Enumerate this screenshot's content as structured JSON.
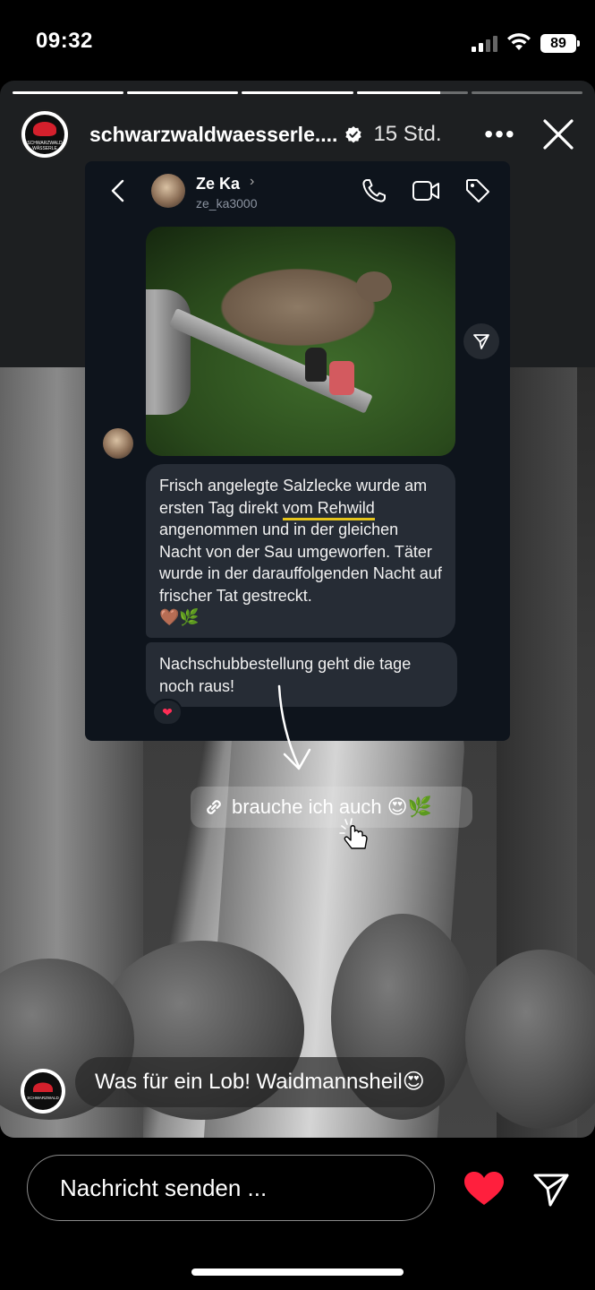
{
  "status_bar": {
    "time": "09:32",
    "battery": "89"
  },
  "story": {
    "username": "schwarzwaldwaesserle....",
    "time_ago": "15 Std.",
    "more": "•••",
    "progress": [
      1,
      1,
      1,
      0.75,
      0
    ]
  },
  "dm": {
    "contact_name": "Ze Ka",
    "contact_handle": "ze_ka3000",
    "message1_before": "Frisch angelegte Salzlecke  wurde am ersten Tag direkt ",
    "message1_highlight": "vom Rehwild",
    "message1_after": " angenommen  und in der gleichen Nacht von der Sau umgeworfen. Täter wurde in der darauffolgenden Nacht  auf frischer Tat gestreckt.",
    "message1_emoji": "🤎🌿",
    "message2": "Nachschubbestellung geht die tage noch raus!",
    "reaction": "❤"
  },
  "link_sticker": {
    "label": "brauche ich auch 😍🌿"
  },
  "reply": {
    "text": "Was für ein Lob! Waidmannsheil😍"
  },
  "bottom": {
    "placeholder": "Nachricht senden ..."
  },
  "colors": {
    "heart": "#ff1f3d",
    "highlight": "#e4c41b",
    "bubble": "#262c35"
  }
}
